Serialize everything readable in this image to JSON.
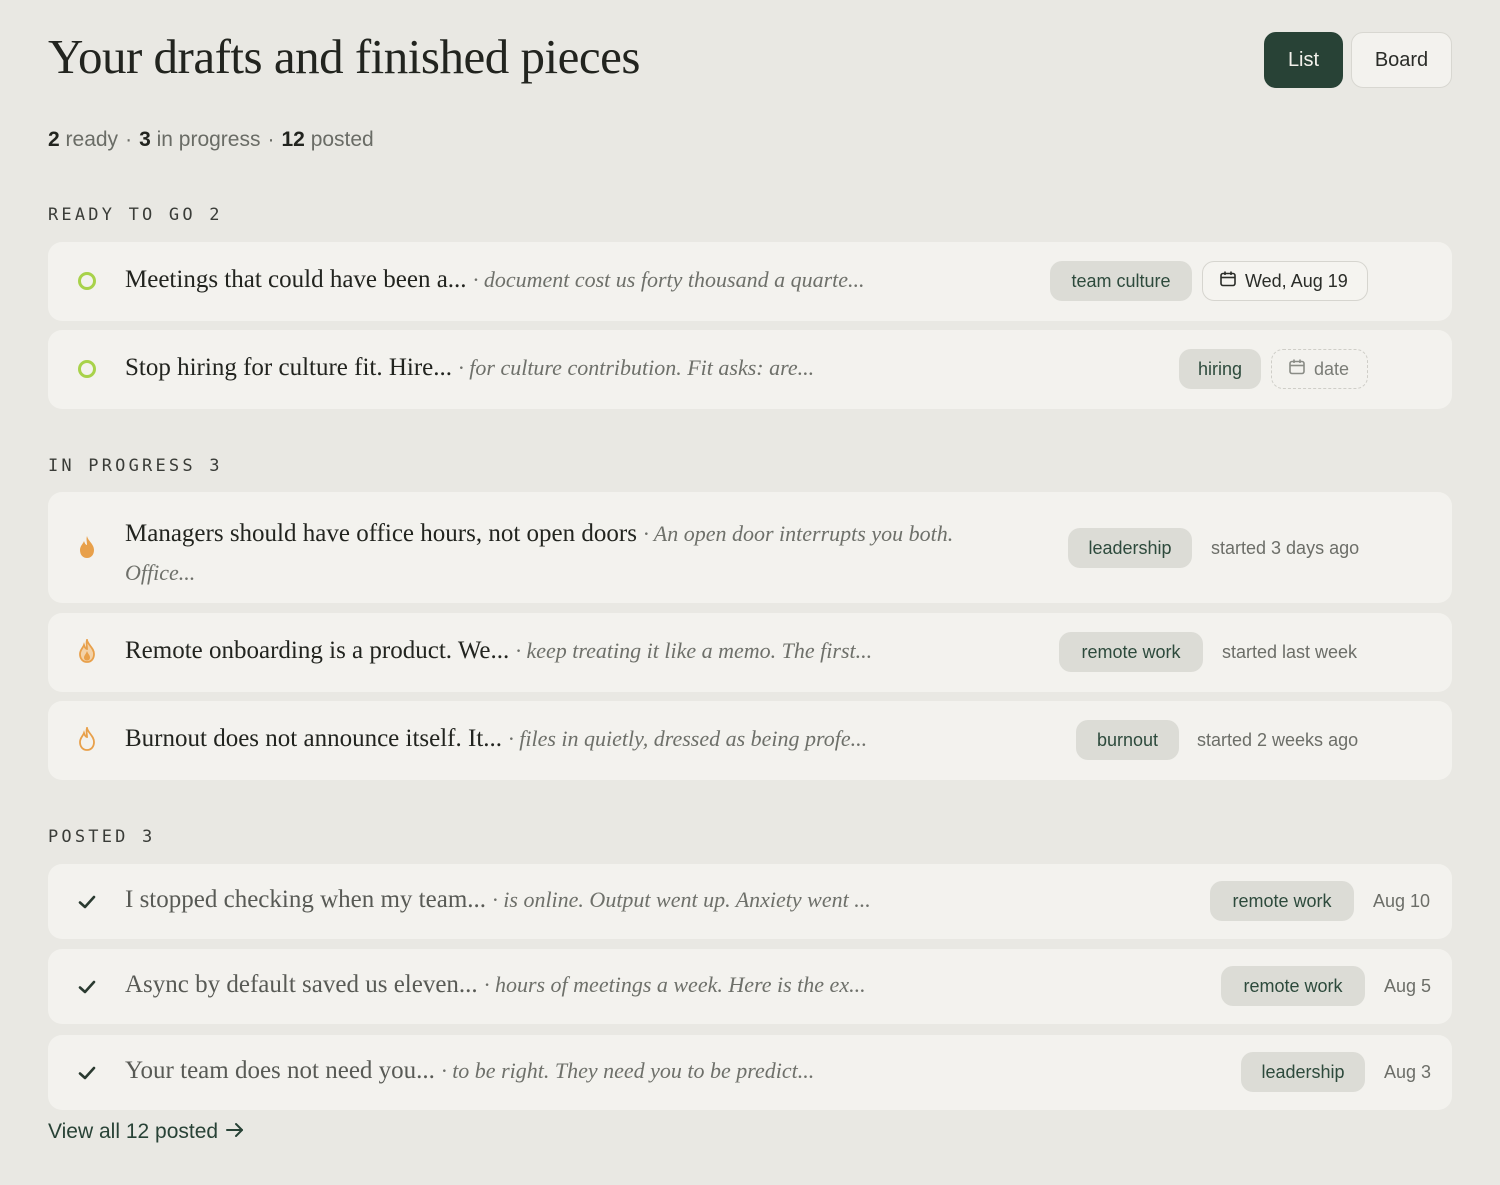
{
  "header": {
    "title": "Your drafts and finished pieces",
    "view_list": "List",
    "view_board": "Board"
  },
  "summary": {
    "ready_count": "2",
    "ready_label": "ready",
    "progress_count": "3",
    "progress_label": "in progress",
    "posted_count": "12",
    "posted_label": "posted",
    "separator": "·"
  },
  "sections": {
    "ready": {
      "label": "READY TO GO",
      "count": "2"
    },
    "progress": {
      "label": "IN PROGRESS",
      "count": "3"
    },
    "posted": {
      "label": "POSTED",
      "count": "3"
    }
  },
  "ready_items": [
    {
      "title": "Meetings that could have been a...",
      "snippet": "· document cost us forty thousand a quarte...",
      "tag": "team culture",
      "date": "Wed, Aug 19"
    },
    {
      "title": "Stop hiring for culture fit. Hire...",
      "snippet": "· for culture contribution. Fit asks: are...",
      "tag": "hiring",
      "date": "date"
    }
  ],
  "progress_items": [
    {
      "title": "Managers should have office hours, not open doors",
      "snippet": "· An open door interrupts you both.",
      "snippet2": "Office...",
      "tag": "leadership",
      "meta": "started 3 days ago"
    },
    {
      "title": "Remote onboarding is a product. We...",
      "snippet": "· keep treating it like a memo. The first...",
      "tag": "remote work",
      "meta": "started last week"
    },
    {
      "title": "Burnout does not announce itself. It...",
      "snippet": "· files in quietly, dressed as being profe...",
      "tag": "burnout",
      "meta": "started 2 weeks ago"
    }
  ],
  "posted_items": [
    {
      "title": "I stopped checking when my team...",
      "snippet": "· is online. Output went up. Anxiety went ...",
      "tag": "remote work",
      "date": "Aug 10"
    },
    {
      "title": "Async by default saved us eleven...",
      "snippet": "· hours of meetings a week. Here is the ex...",
      "tag": "remote work",
      "date": "Aug 5"
    },
    {
      "title": "Your team does not need you...",
      "snippet": "· to be right. They need you to be predict...",
      "tag": "leadership",
      "date": "Aug 3"
    }
  ],
  "footer": {
    "view_all": "View all 12 posted"
  },
  "icons": {
    "ready_status": "circle-outline-icon",
    "progress_status": "flame-icon",
    "posted_status": "check-icon",
    "date": "calendar-icon",
    "arrow": "arrow-right-icon"
  },
  "colors": {
    "accent": "#284236",
    "ready_ring": "#a8d24a",
    "flame": "#e8a04a",
    "background": "#e9e8e3",
    "card": "#f3f2ee"
  }
}
